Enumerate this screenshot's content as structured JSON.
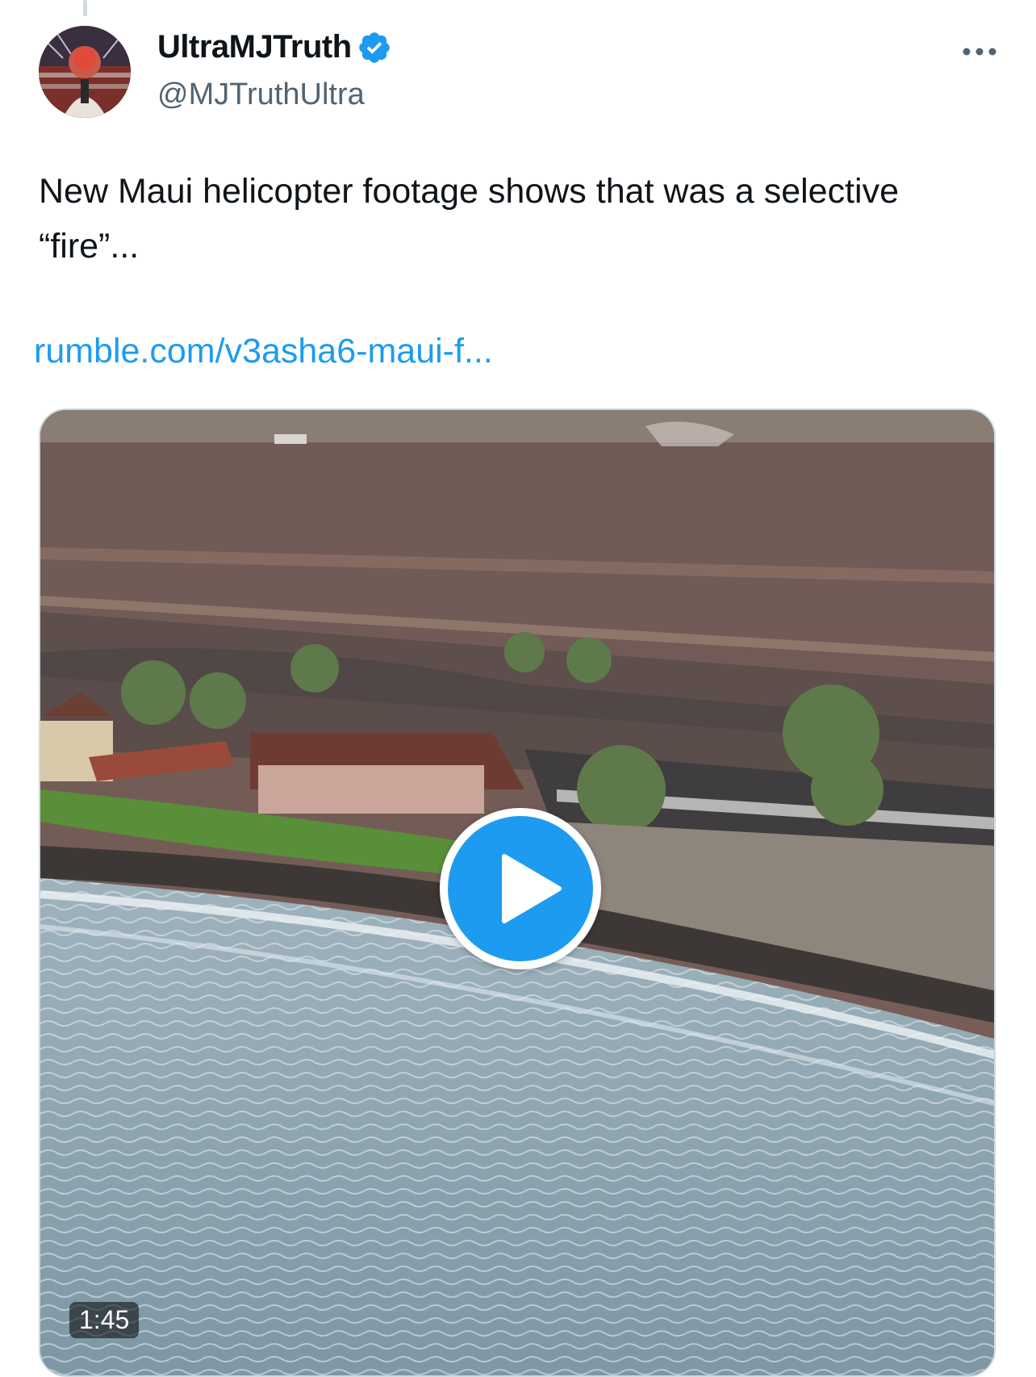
{
  "author": {
    "display_name": "UltraMJTruth",
    "handle": "@MJTruthUltra",
    "verified": true
  },
  "tweet": {
    "text": "New Maui helicopter footage shows that was a selective “fire”...",
    "link": "rumble.com/v3asha6-maui-f..."
  },
  "media": {
    "type": "video",
    "duration": "1:45"
  },
  "icons": {
    "verified": "verified-badge-icon",
    "more": "more-horizontal-icon",
    "play": "play-icon"
  },
  "colors": {
    "accent": "#1d9bf0",
    "text": "#0f1419",
    "secondary_text": "#536471",
    "border": "#cfd9de"
  }
}
